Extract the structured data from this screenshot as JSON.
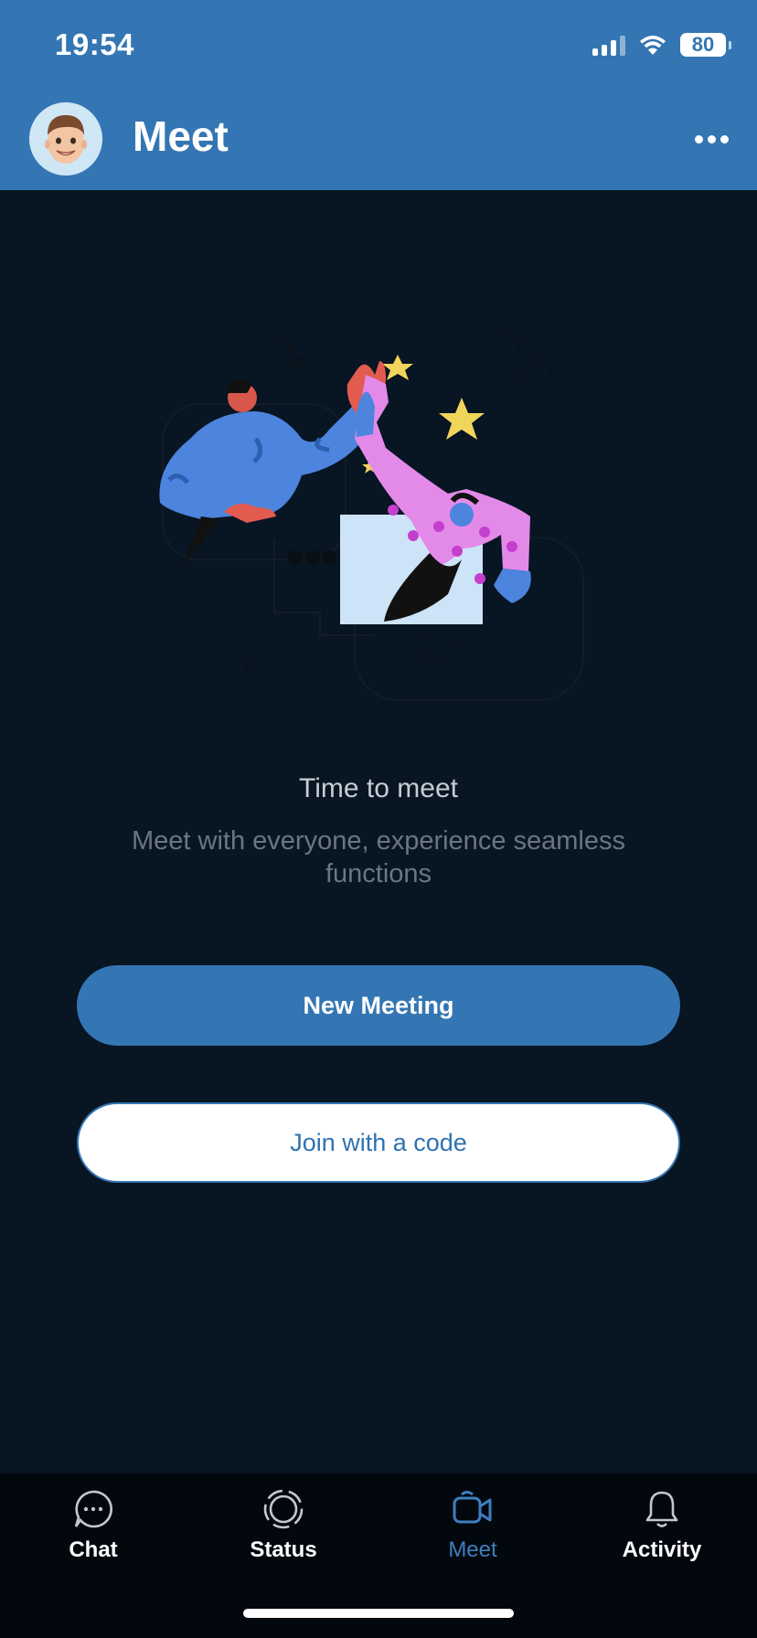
{
  "status_bar": {
    "time": "19:54",
    "battery": "80"
  },
  "header": {
    "title": "Meet"
  },
  "content": {
    "headline": "Time to meet",
    "subline": "Meet with everyone, experience seamless functions"
  },
  "actions": {
    "new_meeting": "New Meeting",
    "join_code": "Join with a code"
  },
  "tabs": [
    {
      "label": "Chat",
      "icon": "chat-bubble-icon"
    },
    {
      "label": "Status",
      "icon": "status-icon"
    },
    {
      "label": "Meet",
      "icon": "video-camera-icon",
      "active": true
    },
    {
      "label": "Activity",
      "icon": "bell-icon"
    }
  ],
  "colors": {
    "accent": "#3476b3",
    "background": "#081522",
    "tabbar": "#03080e"
  }
}
